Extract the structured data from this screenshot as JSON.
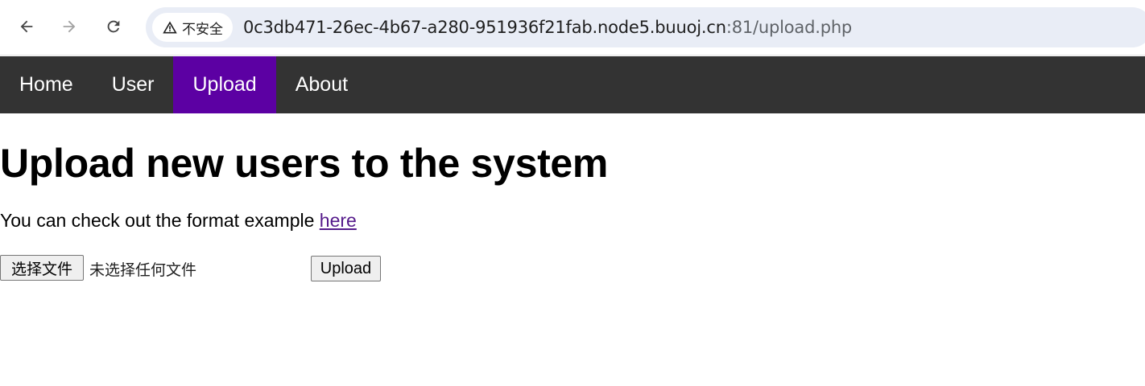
{
  "browser": {
    "security_label": "不安全",
    "url_host": "0c3db471-26ec-4b67-a280-951936f21fab.node5.buuoj.cn",
    "url_path": ":81/upload.php"
  },
  "navbar": {
    "items": [
      {
        "label": "Home"
      },
      {
        "label": "User"
      },
      {
        "label": "Upload",
        "active": true
      },
      {
        "label": "About"
      }
    ],
    "background": "#333333",
    "active_color": "#5c00a3"
  },
  "main": {
    "title": "Upload new users to the system",
    "intro_text": "You can check out the format example ",
    "intro_link": "here",
    "file_button_label": "选择文件",
    "file_status": "未选择任何文件",
    "submit_label": "Upload"
  }
}
